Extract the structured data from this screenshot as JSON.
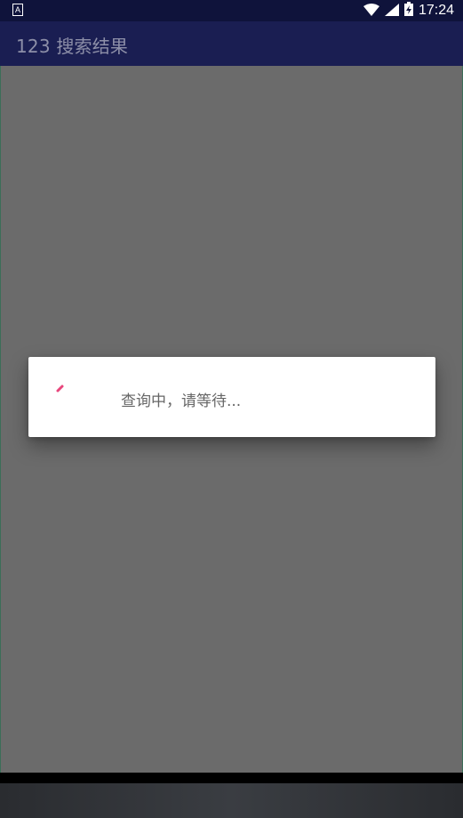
{
  "status_bar": {
    "left_icon": "A",
    "time": "17:24",
    "icons": [
      "wifi-icon",
      "signal-icon",
      "battery-charging-icon"
    ]
  },
  "app_bar": {
    "title": "123 搜索结果"
  },
  "dialog": {
    "message": "查询中，请等待...",
    "spinner_color": "#e8467c"
  },
  "colors": {
    "app_bar": "#1a1e52",
    "status_bar": "#0f133b",
    "scrim": "#6b6b6b",
    "dialog_bg": "#ffffff"
  }
}
